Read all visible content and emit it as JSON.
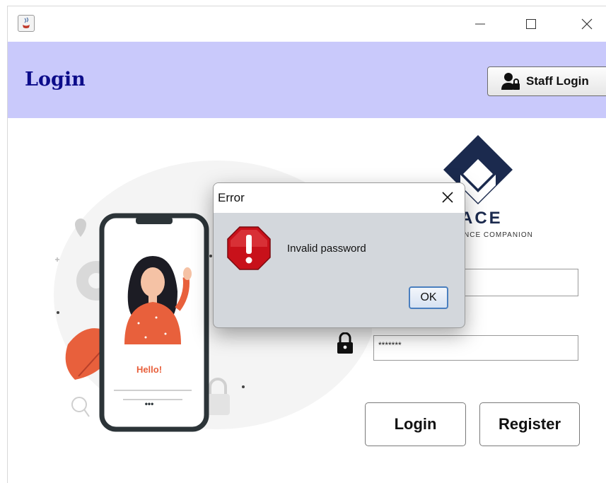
{
  "window": {
    "icon": "java-icon",
    "controls": [
      "minimize-icon",
      "maximize-icon",
      "close-icon"
    ]
  },
  "header": {
    "title": "Login",
    "staff_button_label": "Staff Login",
    "staff_button_icon": "user-lock-icon",
    "background_color": "#c9c9fb",
    "title_color": "#0c0c8a"
  },
  "brand": {
    "logo_text": "ACE",
    "tagline": "NCE COMPANION"
  },
  "illustration": {
    "phone_text": "Hello!",
    "phone_footer": "•••"
  },
  "form": {
    "username_value": "",
    "password_value": "*******",
    "password_icon": "lock-icon"
  },
  "buttons": {
    "login_label": "Login",
    "register_label": "Register"
  },
  "dialog": {
    "title": "Error",
    "message": "Invalid password",
    "ok_label": "OK",
    "icon": "error-octagon-icon"
  }
}
